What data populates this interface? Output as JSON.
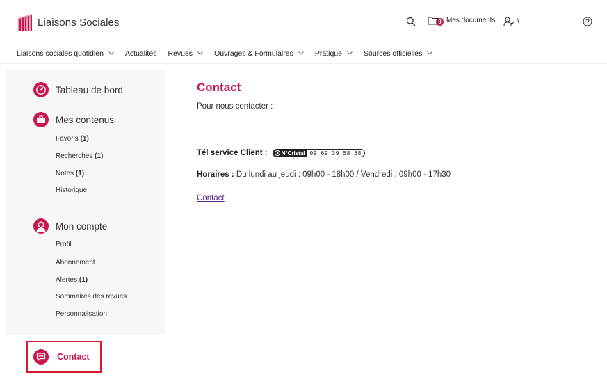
{
  "header": {
    "brand": "Liaisons Sociales",
    "documents_count": "0",
    "documents_label": "Mes documents",
    "user_name": "\\"
  },
  "nav": {
    "items": [
      {
        "label": "Liaisons sociales quotidien",
        "has_menu": true
      },
      {
        "label": "Actualités",
        "has_menu": false
      },
      {
        "label": "Revues",
        "has_menu": true
      },
      {
        "label": "Ouvrages & Formulaires",
        "has_menu": true
      },
      {
        "label": "Pratique",
        "has_menu": true
      },
      {
        "label": "Sources officielles",
        "has_menu": true
      }
    ]
  },
  "sidebar": {
    "dashboard": "Tableau de bord",
    "contents": {
      "title": "Mes contenus",
      "items": [
        {
          "label": "Favoris",
          "count": "(1)"
        },
        {
          "label": "Recherches",
          "count": "(1)"
        },
        {
          "label": "Notes",
          "count": "(1)"
        },
        {
          "label": "Historique",
          "count": ""
        }
      ]
    },
    "account": {
      "title": "Mon compte",
      "items": [
        {
          "label": "Profil",
          "count": ""
        },
        {
          "label": "Abonnement",
          "count": ""
        },
        {
          "label": "Alertes",
          "count": "(1)"
        },
        {
          "label": "Sommaires des revues",
          "count": ""
        },
        {
          "label": "Personnalisation",
          "count": ""
        }
      ]
    },
    "contact": "Contact"
  },
  "main": {
    "title": "Contact",
    "subtitle": "Pour nous contacter :",
    "tel_label": "Tél service Client :",
    "cristal_brand": "N°Cristal",
    "cristal_number": "09 69 39 58 58",
    "hours_label": "Horaires :",
    "hours_value": " Du lundi au jeudi : 09h00 - 18h00 / Vendredi : 09h00 - 17h30",
    "contact_link": "Contact"
  },
  "colors": {
    "accent": "#c8184e",
    "highlight_border": "#d21d2b",
    "link": "#5a2a8a"
  }
}
